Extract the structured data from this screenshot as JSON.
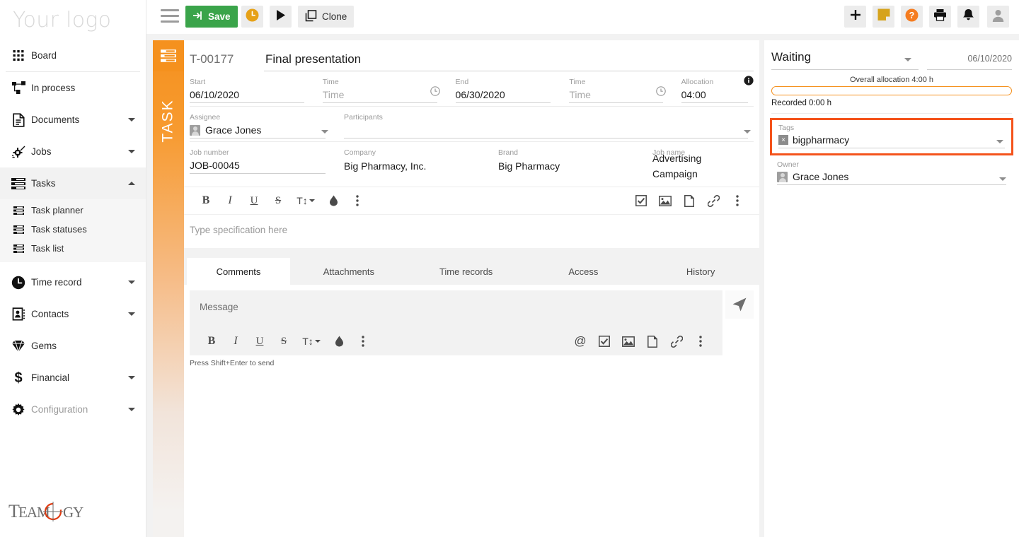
{
  "brand": {
    "logo_text": "Your logo",
    "footer_logo_text": "TEAMOGY"
  },
  "sidebar": {
    "items": [
      {
        "label": "Board",
        "icon": "grid-icon",
        "caret": "none"
      },
      {
        "label": "In process",
        "icon": "workflow-icon",
        "caret": "none"
      },
      {
        "label": "Documents",
        "icon": "document-icon",
        "caret": "down"
      },
      {
        "label": "Jobs",
        "icon": "jobs-gear-icon",
        "caret": "down"
      },
      {
        "label": "Tasks",
        "icon": "tasks-icon",
        "caret": "up"
      },
      {
        "label": "Time record",
        "icon": "clock-icon",
        "caret": "down"
      },
      {
        "label": "Contacts",
        "icon": "contacts-icon",
        "caret": "down"
      },
      {
        "label": "Gems",
        "icon": "gem-icon",
        "caret": "none"
      },
      {
        "label": "Financial",
        "icon": "dollar-icon",
        "caret": "down"
      },
      {
        "label": "Configuration",
        "icon": "gear-icon",
        "caret": "down"
      }
    ],
    "tasks_submenu": [
      {
        "label": "Task planner",
        "icon": "list-icon"
      },
      {
        "label": "Task statuses",
        "icon": "list-icon"
      },
      {
        "label": "Task list",
        "icon": "list-icon"
      }
    ]
  },
  "toolbar": {
    "menu_icon": "hamburger-icon",
    "save_label": "Save",
    "save_icon": "login-arrow-icon",
    "timer_icon": "clock-orange-icon",
    "play_icon": "play-icon",
    "clone_label": "Clone",
    "clone_icon": "copy-icon",
    "right_icons": [
      {
        "name": "plus-icon"
      },
      {
        "name": "note-icon"
      },
      {
        "name": "help-icon"
      },
      {
        "name": "print-icon"
      },
      {
        "name": "bell-icon"
      },
      {
        "name": "user-avatar-icon"
      }
    ]
  },
  "task": {
    "side_tab_label": "TASK",
    "side_tab_icon": "tasks-icon",
    "code": "T-00177",
    "title": "Final presentation",
    "fields": {
      "start_label": "Start",
      "start_value": "06/10/2020",
      "start_time_label": "Time",
      "start_time_placeholder": "Time",
      "end_label": "End",
      "end_value": "06/30/2020",
      "end_time_label": "Time",
      "end_time_placeholder": "Time",
      "allocation_label": "Allocation",
      "allocation_value": "04:00",
      "assignee_label": "Assignee",
      "assignee_value": "Grace Jones",
      "participants_label": "Participants",
      "participants_value": "",
      "job_number_label": "Job number",
      "job_number_value": "JOB-00045",
      "company_label": "Company",
      "company_value": "Big Pharmacy, Inc.",
      "brand_label": "Brand",
      "brand_value": "Big Pharmacy",
      "job_name_label": "Job name",
      "job_name_value": "Advertising Campaign"
    }
  },
  "spec_editor": {
    "placeholder": "Type specification here",
    "left_tools": [
      {
        "name": "bold-icon",
        "glyph": "B"
      },
      {
        "name": "italic-icon",
        "glyph": "I"
      },
      {
        "name": "underline-icon",
        "glyph": "U"
      },
      {
        "name": "strikethrough-icon",
        "glyph": "S"
      },
      {
        "name": "font-size-icon",
        "glyph": "T↕"
      },
      {
        "name": "text-color-icon",
        "glyph": "drop"
      },
      {
        "name": "more-options-icon",
        "glyph": "dots"
      }
    ],
    "right_tools": [
      {
        "name": "checklist-icon"
      },
      {
        "name": "image-icon"
      },
      {
        "name": "file-icon"
      },
      {
        "name": "link-icon"
      },
      {
        "name": "more-options-icon"
      }
    ]
  },
  "tabs": [
    {
      "label": "Comments",
      "active": true
    },
    {
      "label": "Attachments",
      "active": false
    },
    {
      "label": "Time records",
      "active": false
    },
    {
      "label": "Access",
      "active": false
    },
    {
      "label": "History",
      "active": false
    }
  ],
  "comment_editor": {
    "placeholder": "Message",
    "hint": "Press Shift+Enter to send",
    "send_icon": "send-icon",
    "left_tools": [
      {
        "name": "bold-icon",
        "glyph": "B"
      },
      {
        "name": "italic-icon",
        "glyph": "I"
      },
      {
        "name": "underline-icon",
        "glyph": "U"
      },
      {
        "name": "strikethrough-icon",
        "glyph": "S"
      },
      {
        "name": "font-size-icon",
        "glyph": "T↕"
      },
      {
        "name": "text-color-icon",
        "glyph": "drop"
      },
      {
        "name": "more-options-icon",
        "glyph": "dots"
      }
    ],
    "right_tools": [
      {
        "name": "mention-icon"
      },
      {
        "name": "checklist-icon"
      },
      {
        "name": "image-icon"
      },
      {
        "name": "file-icon"
      },
      {
        "name": "link-icon"
      },
      {
        "name": "more-options-icon"
      }
    ]
  },
  "right_panel": {
    "status": "Waiting",
    "status_date": "06/10/2020",
    "overall_allocation": "Overall allocation 4:00 h",
    "recorded": "Recorded 0:00 h",
    "progress_percent": 0,
    "tags_label": "Tags",
    "tag_value": "bigpharmacy",
    "tag_remove_glyph": "×",
    "owner_label": "Owner",
    "owner_value": "Grace Jones"
  },
  "colors": {
    "accent_orange": "#f5911e",
    "highlight_orange": "#f4531b",
    "save_green": "#3aa44a",
    "panel_gray": "#f2f2f2",
    "text_dark": "#1a1a1a",
    "label_gray": "#9b9b9b"
  }
}
